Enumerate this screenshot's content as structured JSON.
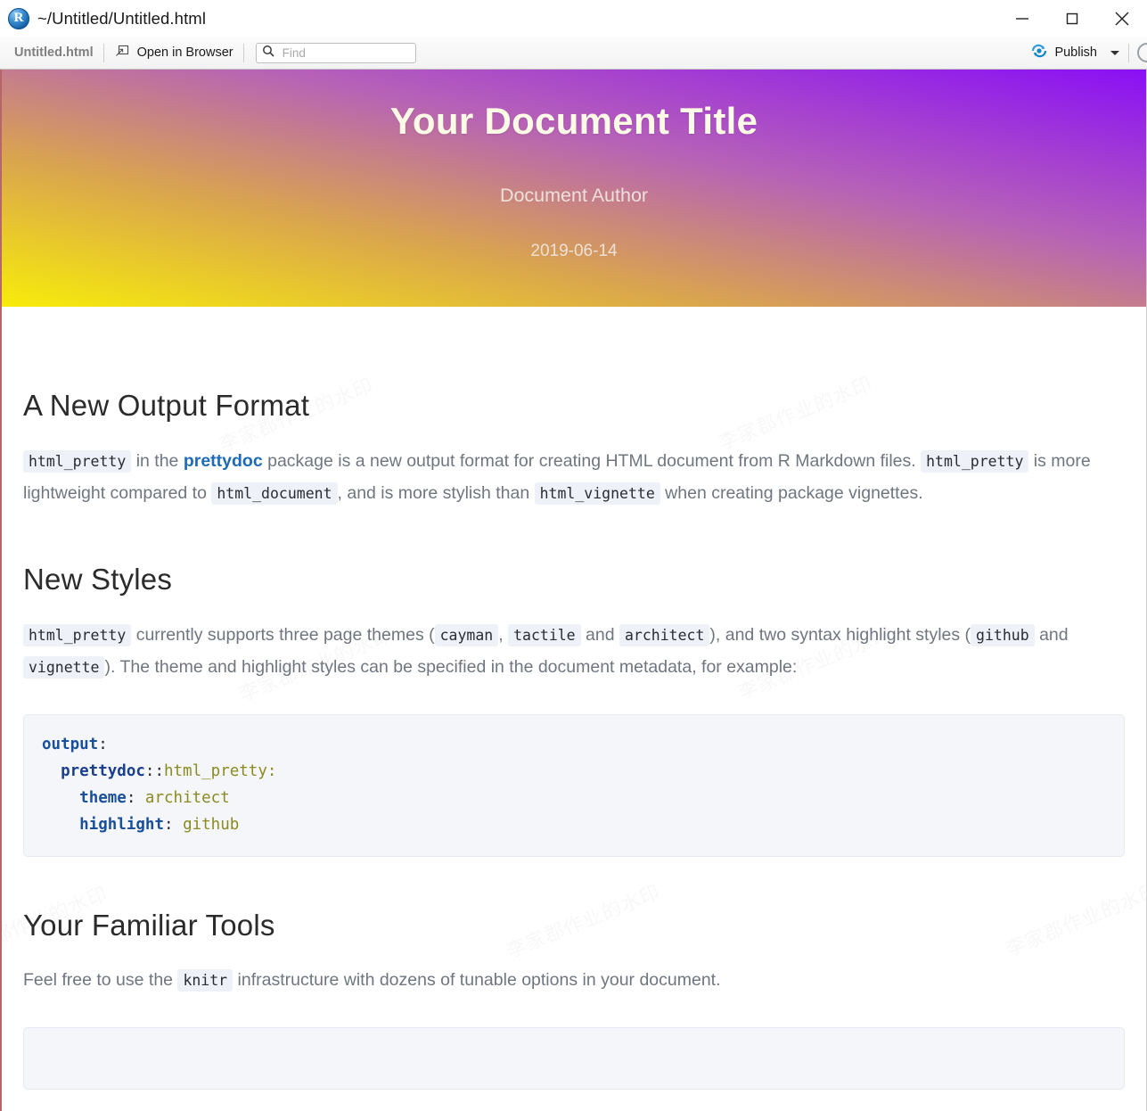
{
  "window": {
    "title": "~/Untitled/Untitled.html",
    "app_icon": "r-logo-icon",
    "minimize_label": "minimize-icon",
    "maximize_label": "maximize-icon",
    "close_label": "close-icon"
  },
  "toolbar": {
    "filename": "Untitled.html",
    "open_in_browser": "Open in Browser",
    "open_in_browser_icon": "open-external-icon",
    "find_placeholder": "Find",
    "find_value": "",
    "find_icon": "search-icon",
    "publish_label": "Publish",
    "publish_icon": "publish-icon",
    "publish_dropdown_icon": "chevron-down-icon",
    "settings_icon": "gear-icon"
  },
  "banner": {
    "title": "Your Document Title",
    "author": "Document Author",
    "date": "2019-06-14",
    "gradient_from": "#f7ec0a",
    "gradient_to": "#8a0ff5",
    "title_color": "#fdfbe6"
  },
  "watermark": {
    "text": "李家郡作业的水印"
  },
  "document": {
    "sections": [
      {
        "heading": "A New Output Format",
        "paragraph": {
          "parts": [
            {
              "type": "code",
              "text": "html_pretty"
            },
            {
              "type": "text",
              "text": " in the "
            },
            {
              "type": "link",
              "text": "prettydoc"
            },
            {
              "type": "text",
              "text": " package is a new output format for creating HTML document from R Markdown files. "
            },
            {
              "type": "code",
              "text": "html_pretty"
            },
            {
              "type": "text",
              "text": " is more lightweight compared to "
            },
            {
              "type": "code",
              "text": "html_document"
            },
            {
              "type": "text",
              "text": ", and is more stylish than "
            },
            {
              "type": "code",
              "text": "html_vignette"
            },
            {
              "type": "text",
              "text": " when creating package vignettes."
            }
          ]
        }
      },
      {
        "heading": "New Styles",
        "paragraph": {
          "parts": [
            {
              "type": "code",
              "text": "html_pretty"
            },
            {
              "type": "text",
              "text": " currently supports three page themes ("
            },
            {
              "type": "code",
              "text": "cayman"
            },
            {
              "type": "text",
              "text": ", "
            },
            {
              "type": "code",
              "text": "tactile"
            },
            {
              "type": "text",
              "text": " and "
            },
            {
              "type": "code",
              "text": "architect"
            },
            {
              "type": "text",
              "text": "), and two syntax highlight styles ("
            },
            {
              "type": "code",
              "text": "github"
            },
            {
              "type": "text",
              "text": " and "
            },
            {
              "type": "code",
              "text": "vignette"
            },
            {
              "type": "text",
              "text": "). The theme and highlight styles can be specified in the document metadata, for example:"
            }
          ]
        },
        "code_block": {
          "language": "yaml",
          "lines": [
            [
              {
                "cls": "tok-key",
                "t": "output"
              },
              {
                "cls": "tok-punct",
                "t": ":"
              }
            ],
            [
              {
                "cls": "tok-punct",
                "t": "  "
              },
              {
                "cls": "tok-ns",
                "t": "prettydoc"
              },
              {
                "cls": "tok-punct",
                "t": "::"
              },
              {
                "cls": "tok-attr",
                "t": "html_pretty:"
              }
            ],
            [
              {
                "cls": "tok-punct",
                "t": "    "
              },
              {
                "cls": "tok-key",
                "t": "theme"
              },
              {
                "cls": "tok-punct",
                "t": ": "
              },
              {
                "cls": "tok-val",
                "t": "architect"
              }
            ],
            [
              {
                "cls": "tok-punct",
                "t": "    "
              },
              {
                "cls": "tok-key",
                "t": "highlight"
              },
              {
                "cls": "tok-punct",
                "t": ": "
              },
              {
                "cls": "tok-val",
                "t": "github"
              }
            ]
          ],
          "plain": "output:\n  prettydoc::html_pretty:\n    theme: architect\n    highlight: github"
        }
      },
      {
        "heading": "Your Familiar Tools",
        "paragraph": {
          "parts": [
            {
              "type": "text",
              "text": "Feel free to use the "
            },
            {
              "type": "code",
              "text": "knitr"
            },
            {
              "type": "text",
              "text": " infrastructure with dozens of tunable options in your document."
            }
          ]
        },
        "code_block_truncated": true
      }
    ]
  }
}
